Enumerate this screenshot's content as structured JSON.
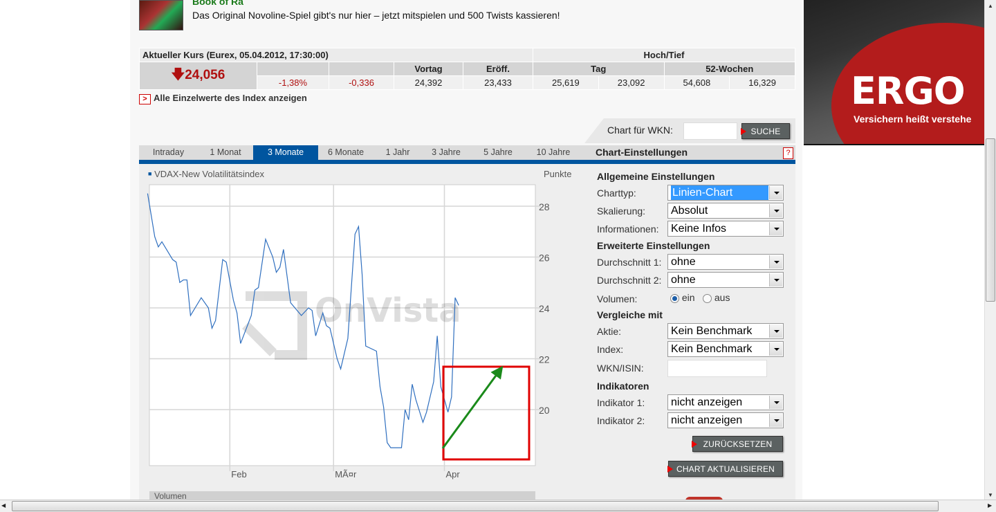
{
  "ad": {
    "title": "Book of Ra",
    "text": "Das Original Novoline-Spiel gibt's nur hier – jetzt mitspielen und 500 Twists kassieren!"
  },
  "quote": {
    "header": "Aktueller Kurs (Eurex, 05.04.2012, 17:30:00)",
    "hochtief": "Hoch/Tief",
    "price": "24,056",
    "direction": "down",
    "cols": {
      "vortag": "Vortag",
      "eroeff": "Eröff.",
      "tag": "Tag",
      "wochen": "52-Wochen"
    },
    "values": {
      "pct": "-1,38%",
      "abs": "-0,336",
      "vortag": "24,392",
      "eroeff": "23,433",
      "tag_hoch": "25,619",
      "tag_tief": "23,092",
      "w_hoch": "54,608",
      "w_tief": "16,329"
    }
  },
  "link_all": "Alle Einzelwerte des Index anzeigen",
  "wkn": {
    "label": "Chart für WKN:",
    "value": "",
    "button": "SUCHE"
  },
  "tabs": [
    {
      "label": "Intraday"
    },
    {
      "label": "1 Monat"
    },
    {
      "label": "3 Monate",
      "active": true
    },
    {
      "label": "6 Monate"
    },
    {
      "label": "1 Jahr"
    },
    {
      "label": "3 Jahre"
    },
    {
      "label": "5 Jahre"
    },
    {
      "label": "10 Jahre"
    }
  ],
  "settings": {
    "title": "Chart-Einstellungen",
    "help": "?",
    "allgemein": "Allgemeine Einstellungen",
    "charttyp_l": "Charttyp:",
    "charttyp": "Linien-Chart",
    "skalierung_l": "Skalierung:",
    "skalierung": "Absolut",
    "info_l": "Informationen:",
    "info": "Keine Infos",
    "erweitert": "Erweiterte Einstellungen",
    "d1_l": "Durchschnitt 1:",
    "d1": "ohne",
    "d2_l": "Durchschnitt 2:",
    "d2": "ohne",
    "vol_l": "Volumen:",
    "vol_ein": "ein",
    "vol_aus": "aus",
    "vol_selected": "ein",
    "vergleiche": "Vergleiche mit",
    "aktie_l": "Aktie:",
    "aktie": "Kein Benchmark",
    "index_l": "Index:",
    "index": "Kein Benchmark",
    "isin_l": "WKN/ISIN:",
    "isin": "",
    "indikatoren": "Indikatoren",
    "i1_l": "Indikator 1:",
    "i1": "nicht anzeigen",
    "i2_l": "Indikator 2:",
    "i2": "nicht anzeigen",
    "reset": "ZURÜCKSETZEN",
    "update": "CHART AKTUALISIEREN"
  },
  "banner": {
    "brand": "ERGO",
    "slogan": "Versichern heißt verstehe"
  },
  "colors": {
    "accent": "#00559f",
    "line": "#2f6fbf",
    "price_down": "#b01010",
    "annotation_box": "#e00000",
    "annotation_arrow": "#1a8a1a"
  },
  "chart_data": {
    "type": "line",
    "legend": "VDAX-New Volatilitätsindex",
    "ylabel": "Punkte",
    "watermark": "OnVista",
    "volume_label": "Volumen",
    "xticks": [
      "Feb",
      "MÃ¤r",
      "Apr"
    ],
    "yticks": [
      "20",
      "22",
      "24",
      "26",
      "28"
    ],
    "ylim": [
      17.8,
      28.8
    ],
    "xlim": [
      "2012-01-08",
      "2012-04-06"
    ],
    "grid": true,
    "series": [
      {
        "name": "VDAX-New Volatilitätsindex",
        "points": [
          [
            "2012-01-09",
            28.5
          ],
          [
            "2012-01-11",
            26.8
          ],
          [
            "2012-01-12",
            26.4
          ],
          [
            "2012-01-13",
            26.6
          ],
          [
            "2012-01-16",
            25.9
          ],
          [
            "2012-01-17",
            25.8
          ],
          [
            "2012-01-18",
            25.0
          ],
          [
            "2012-01-19",
            25.1
          ],
          [
            "2012-01-20",
            25.1
          ],
          [
            "2012-01-21",
            23.7
          ],
          [
            "2012-01-24",
            24.4
          ],
          [
            "2012-01-26",
            24.0
          ],
          [
            "2012-01-27",
            23.2
          ],
          [
            "2012-01-28",
            23.5
          ],
          [
            "2012-01-30",
            25.9
          ],
          [
            "2012-01-31",
            25.8
          ],
          [
            "2012-02-02",
            24.3
          ],
          [
            "2012-02-03",
            23.8
          ],
          [
            "2012-02-04",
            22.6
          ],
          [
            "2012-02-07",
            23.7
          ],
          [
            "2012-02-08",
            24.7
          ],
          [
            "2012-02-09",
            24.8
          ],
          [
            "2012-02-11",
            26.7
          ],
          [
            "2012-02-13",
            26.0
          ],
          [
            "2012-02-14",
            25.4
          ],
          [
            "2012-02-15",
            25.6
          ],
          [
            "2012-02-16",
            26.3
          ],
          [
            "2012-02-18",
            24.2
          ],
          [
            "2012-02-21",
            23.7
          ],
          [
            "2012-02-23",
            24.0
          ],
          [
            "2012-02-24",
            23.9
          ],
          [
            "2012-02-25",
            22.9
          ],
          [
            "2012-02-27",
            23.8
          ],
          [
            "2012-02-28",
            23.3
          ],
          [
            "2012-02-29",
            23.2
          ],
          [
            "2012-03-02",
            22.0
          ],
          [
            "2012-03-03",
            21.6
          ],
          [
            "2012-03-05",
            22.8
          ],
          [
            "2012-03-07",
            26.9
          ],
          [
            "2012-03-08",
            27.2
          ],
          [
            "2012-03-09",
            25.3
          ],
          [
            "2012-03-10",
            22.5
          ],
          [
            "2012-03-13",
            22.3
          ],
          [
            "2012-03-14",
            20.9
          ],
          [
            "2012-03-15",
            20.1
          ],
          [
            "2012-03-16",
            18.7
          ],
          [
            "2012-03-17",
            18.5
          ],
          [
            "2012-03-18",
            18.5
          ],
          [
            "2012-03-20",
            18.5
          ],
          [
            "2012-03-21",
            20.0
          ],
          [
            "2012-03-22",
            19.6
          ],
          [
            "2012-03-23",
            21.0
          ],
          [
            "2012-03-24",
            20.4
          ],
          [
            "2012-03-26",
            19.5
          ],
          [
            "2012-03-27",
            19.9
          ],
          [
            "2012-03-29",
            21.1
          ],
          [
            "2012-03-30",
            22.9
          ],
          [
            "2012-03-31",
            20.9
          ],
          [
            "2012-04-02",
            19.9
          ],
          [
            "2012-04-03",
            20.5
          ],
          [
            "2012-04-04",
            24.4
          ],
          [
            "2012-04-05",
            24.1
          ]
        ]
      }
    ]
  }
}
